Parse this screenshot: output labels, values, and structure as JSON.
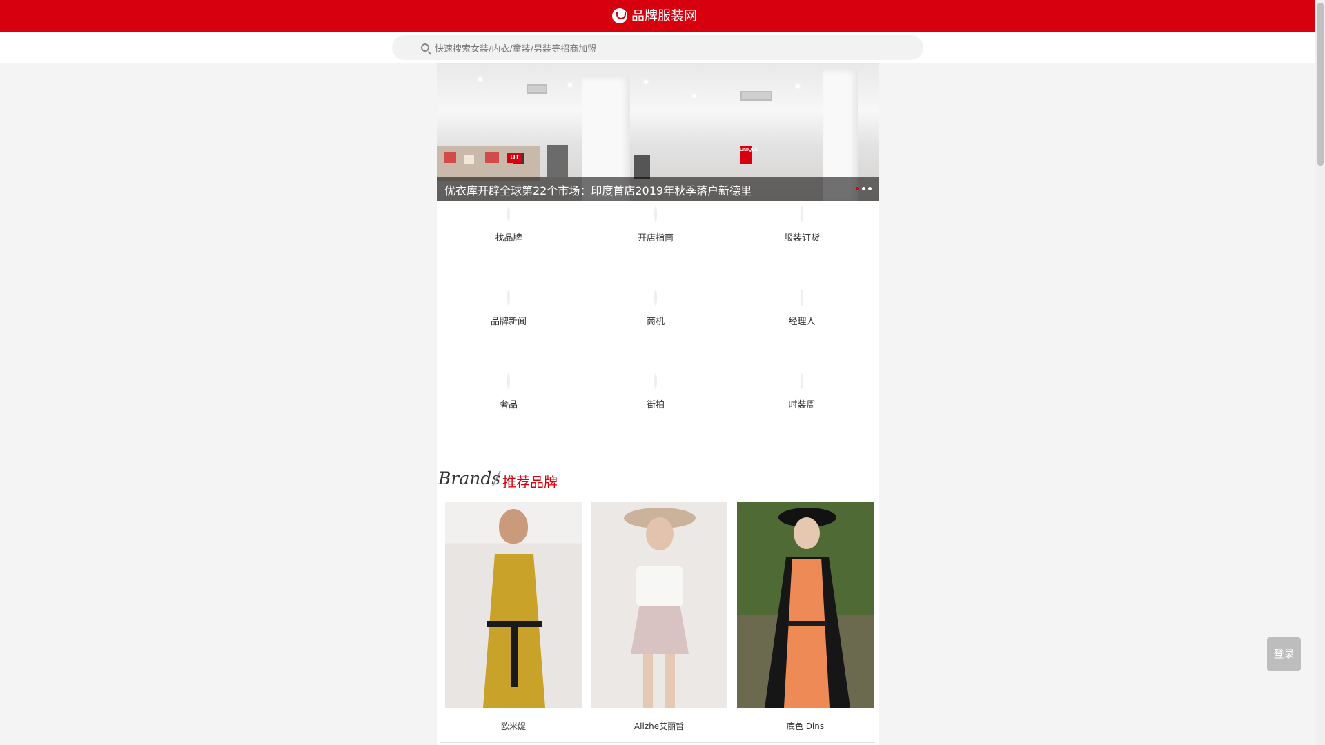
{
  "header": {
    "site_name": "品牌服装网",
    "brand_color": "#d7000f"
  },
  "search": {
    "placeholder": "快速搜索女装/内衣/童装/男装等招商加盟"
  },
  "banner": {
    "caption": "优衣库开辟全球第22个市场：印度首店2019年秋季落户新德里",
    "store_sign": "UT",
    "store_sign_2": "UNIQLO",
    "slides": 3,
    "active_slide": 1
  },
  "categories": [
    {
      "label": "找品牌",
      "icon": "brand-collage-icon"
    },
    {
      "label": "开店指南",
      "icon": "handshake-icon"
    },
    {
      "label": "服装订货",
      "icon": "order-fair-icon"
    },
    {
      "label": "品牌新闻",
      "icon": "camera-icon"
    },
    {
      "label": "商机",
      "icon": "dollar-icon"
    },
    {
      "label": "经理人",
      "icon": "managers-icon"
    },
    {
      "label": "奢品",
      "icon": "luxury-icon"
    },
    {
      "label": "街拍",
      "icon": "street-snap-icon"
    },
    {
      "label": "时装周",
      "icon": "fashion-week-icon"
    }
  ],
  "brands_section": {
    "title_en": "Brands",
    "title_cn": "推荐品牌",
    "items": [
      {
        "name": "欧米媞"
      },
      {
        "name": "Allzhe艾丽哲"
      },
      {
        "name": "底色 Dins"
      }
    ]
  },
  "login": {
    "label": "登录"
  }
}
